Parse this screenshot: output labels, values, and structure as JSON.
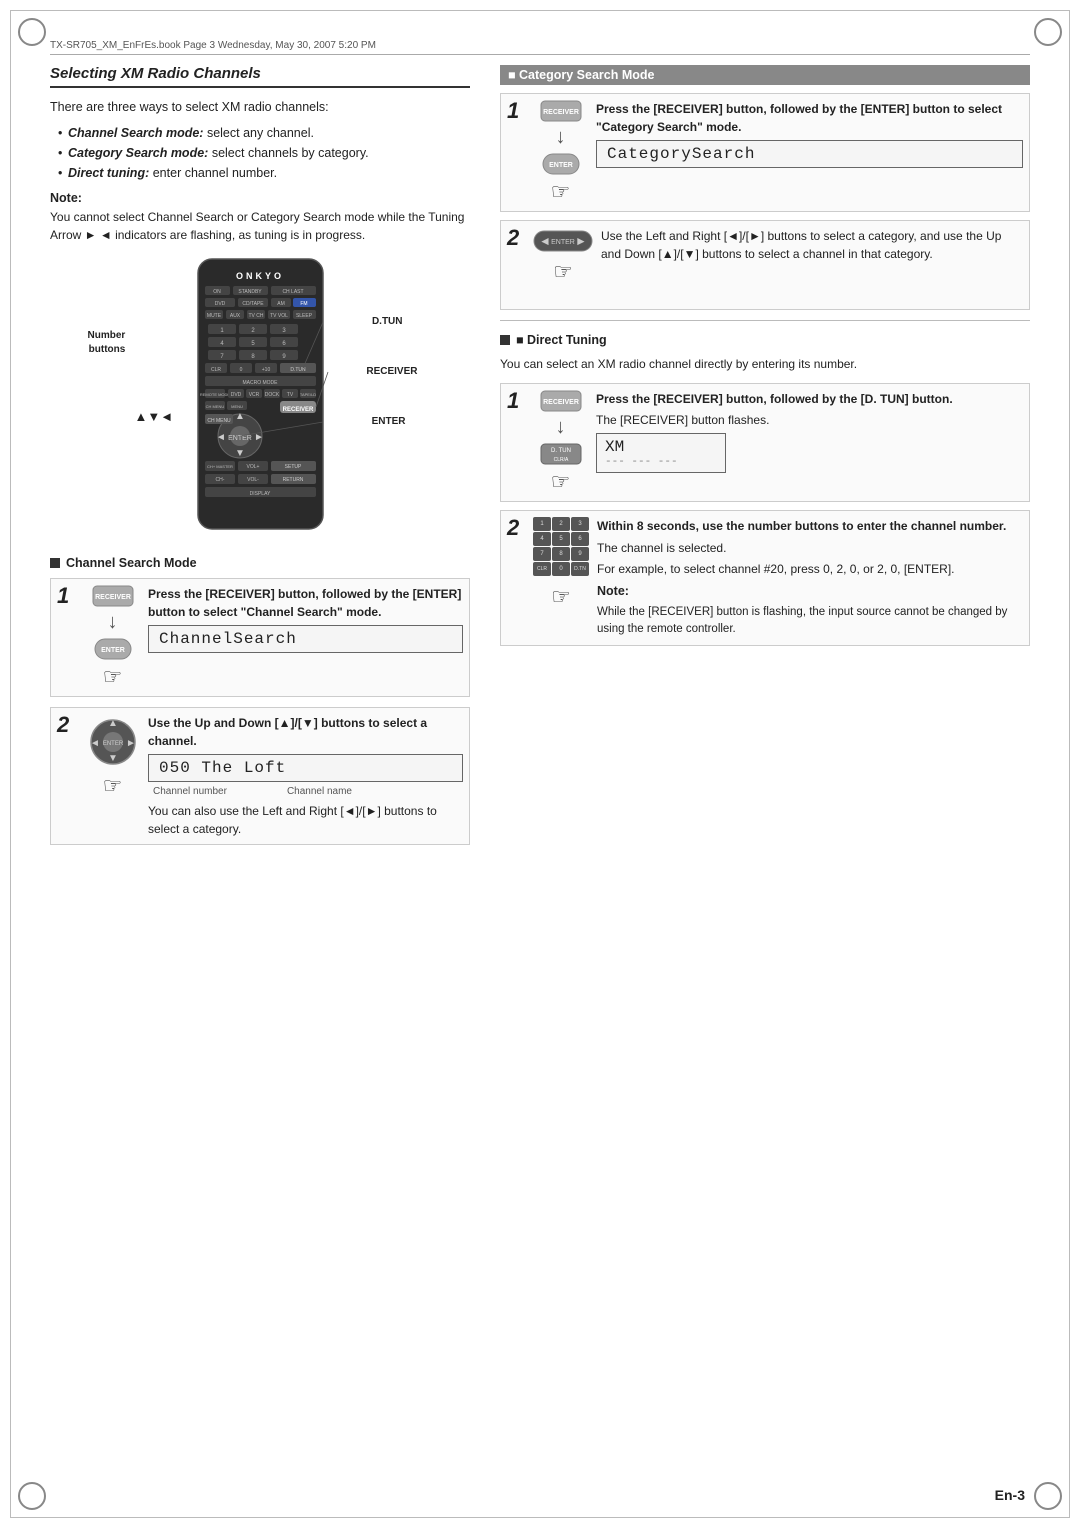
{
  "page": {
    "header": "TX-SR705_XM_EnFrEs.book  Page 3  Wednesday, May 30, 2007  5:20 PM",
    "footer": "En-3"
  },
  "left_col": {
    "section_title": "Selecting XM Radio Channels",
    "intro": "There are three ways to select XM radio channels:",
    "bullets": [
      {
        "label": "Channel Search mode:",
        "text": " select any channel."
      },
      {
        "label": "Category Search mode:",
        "text": " select channels by category."
      },
      {
        "label": "Direct tuning:",
        "text": " enter channel number."
      }
    ],
    "note_label": "Note:",
    "note_text": "You cannot select Channel Search or Category Search mode while the Tuning Arrow ►    ◄ indicators are flashing, as tuning is in progress.",
    "remote_labels": {
      "number_buttons": "Number\nbuttons",
      "dtun": "D.TUN",
      "receiver": "RECEIVER",
      "enter": "ENTER"
    },
    "arrow_indicator": "▲▼◄",
    "channel_search": {
      "header": "■ Channel Search Mode",
      "step1": {
        "number": "1",
        "text": "Press the [RECEIVER] button, followed by the [ENTER] button to select \"Channel Search\" mode.",
        "lcd": "ChannelSearch"
      },
      "step2": {
        "number": "2",
        "text": "Use the Up and Down [▲]/[▼] buttons to select a channel.",
        "lcd": "050 The Loft",
        "channel_label": "Channel number",
        "name_label": "Channel name",
        "extra_text": "You can also use the Left and Right [◄]/[►] buttons to select a category."
      }
    }
  },
  "right_col": {
    "category_search": {
      "header": "■ Category Search Mode",
      "step1": {
        "number": "1",
        "text": "Press the [RECEIVER] button, followed by the [ENTER] button to select \"Category Search\" mode.",
        "lcd": "CategorySearch"
      },
      "step2": {
        "number": "2",
        "text": "Use the Left and Right [◄]/[►] buttons to select a category, and use the Up and Down [▲]/[▼] buttons to select a channel in that category."
      }
    },
    "direct_tuning": {
      "header": "■ Direct Tuning",
      "intro": "You can select an XM radio channel directly by entering its number.",
      "step1": {
        "number": "1",
        "text": "Press the [RECEIVER] button, followed by the [D. TUN] button.",
        "sub_text": "The [RECEIVER] button flashes.",
        "lcd_line1": "XM",
        "lcd_line2": "--- --- ---"
      },
      "step2": {
        "number": "2",
        "text": "Within 8 seconds, use the number buttons to enter the channel number.",
        "sub_text1": "The channel is selected.",
        "sub_text2": "For example, to select channel #20, press 0, 2, 0, or 2, 0, [ENTER].",
        "note_label": "Note:",
        "note_text": "While the [RECEIVER] button is flashing, the input source cannot be changed by using the remote controller."
      }
    }
  }
}
